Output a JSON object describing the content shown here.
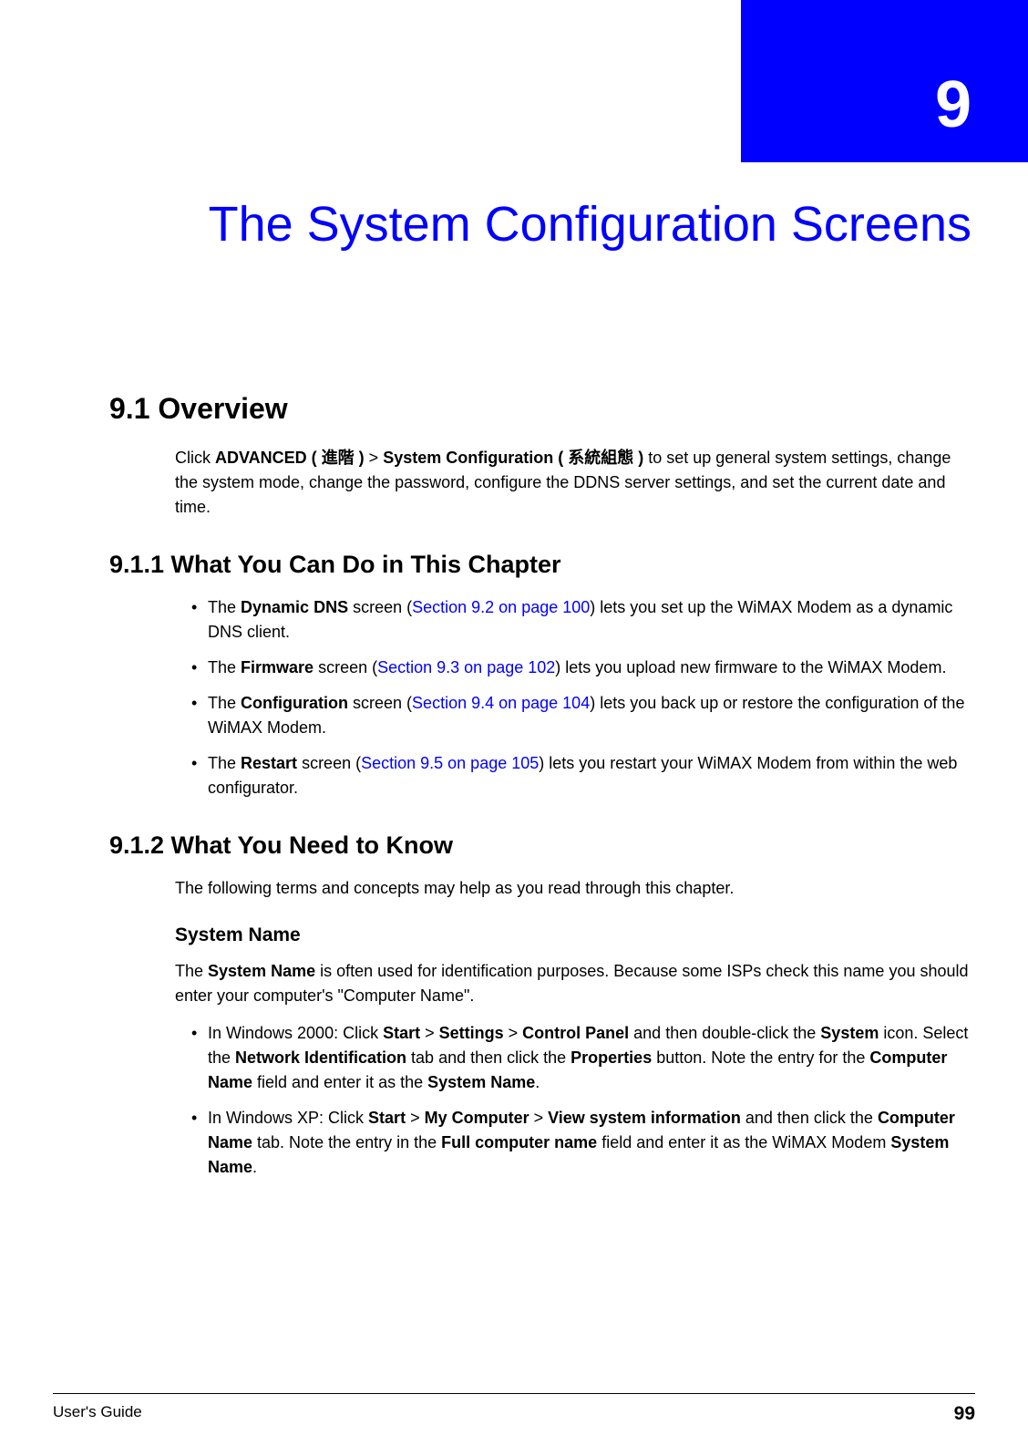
{
  "chapter": {
    "number": "9",
    "title": "The System Configuration Screens"
  },
  "section91": {
    "heading": "9.1  Overview",
    "intro_pre": "Click ",
    "nav1_bold": "ADVANCED ( ",
    "nav1_cjk": "進階",
    "nav1_close": " )",
    "gt1": " > ",
    "nav2_bold": "System Configuration ( ",
    "nav2_cjk": "系統組態",
    "nav2_close": " )",
    "intro_post": " to set up general system settings, change the system mode, change the password, configure the DDNS server settings, and set the current date and time."
  },
  "section911": {
    "heading": "9.1.1  What You Can Do in This Chapter",
    "items": [
      {
        "pre": "The ",
        "screen": "Dynamic DNS",
        "mid": " screen (",
        "link": "Section 9.2 on page 100",
        "post": ") lets you set up the WiMAX Modem as a dynamic DNS client."
      },
      {
        "pre": "The ",
        "screen": "Firmware",
        "mid": " screen (",
        "link": "Section 9.3 on page 102",
        "post": ") lets you upload new firmware to the WiMAX Modem."
      },
      {
        "pre": "The ",
        "screen": "Configuration",
        "mid": " screen (",
        "link": "Section 9.4 on page 104",
        "post": ") lets you back up or restore the configuration of the WiMAX Modem."
      },
      {
        "pre": "The ",
        "screen": "Restart",
        "mid": " screen (",
        "link": "Section 9.5 on page 105",
        "post": ") lets you restart your WiMAX Modem from within the web configurator."
      }
    ]
  },
  "section912": {
    "heading": "9.1.2  What You Need to Know",
    "intro": "The following terms and concepts may help as you read through this chapter.",
    "subhead": "System Name",
    "sysname_p1_pre": "The ",
    "sysname_p1_bold": "System Name",
    "sysname_p1_post": " is often used for identification purposes. Because some ISPs check this name you should enter your computer's  \"Computer Name\".",
    "win2000": {
      "t0": "In Windows 2000: Click ",
      "b1": "Start",
      "t1": " > ",
      "b2": "Settings",
      "t2": " > ",
      "b3": "Control Panel",
      "t3": " and then double-click the ",
      "b4": "System",
      "t4": " icon. Select the ",
      "b5": "Network Identification",
      "t5": " tab and then click the ",
      "b6": "Properties",
      "t6": " button. Note the entry for the ",
      "b7": "Computer Name",
      "t7": " field and enter it as the ",
      "b8": "System Name",
      "t8": "."
    },
    "winxp": {
      "t0": "In Windows XP: Click ",
      "b1": "Start",
      "t1": " > ",
      "b2": "My Computer",
      "t2": " > ",
      "b3": "View system information",
      "t3": " and then click the ",
      "b4": "Computer Name",
      "t4": " tab. Note the entry in the ",
      "b5": "Full computer name",
      "t5": " field and enter it as the WiMAX Modem ",
      "b6": "System Name",
      "t6": "."
    }
  },
  "footer": {
    "left": "User's Guide",
    "right": "99"
  }
}
